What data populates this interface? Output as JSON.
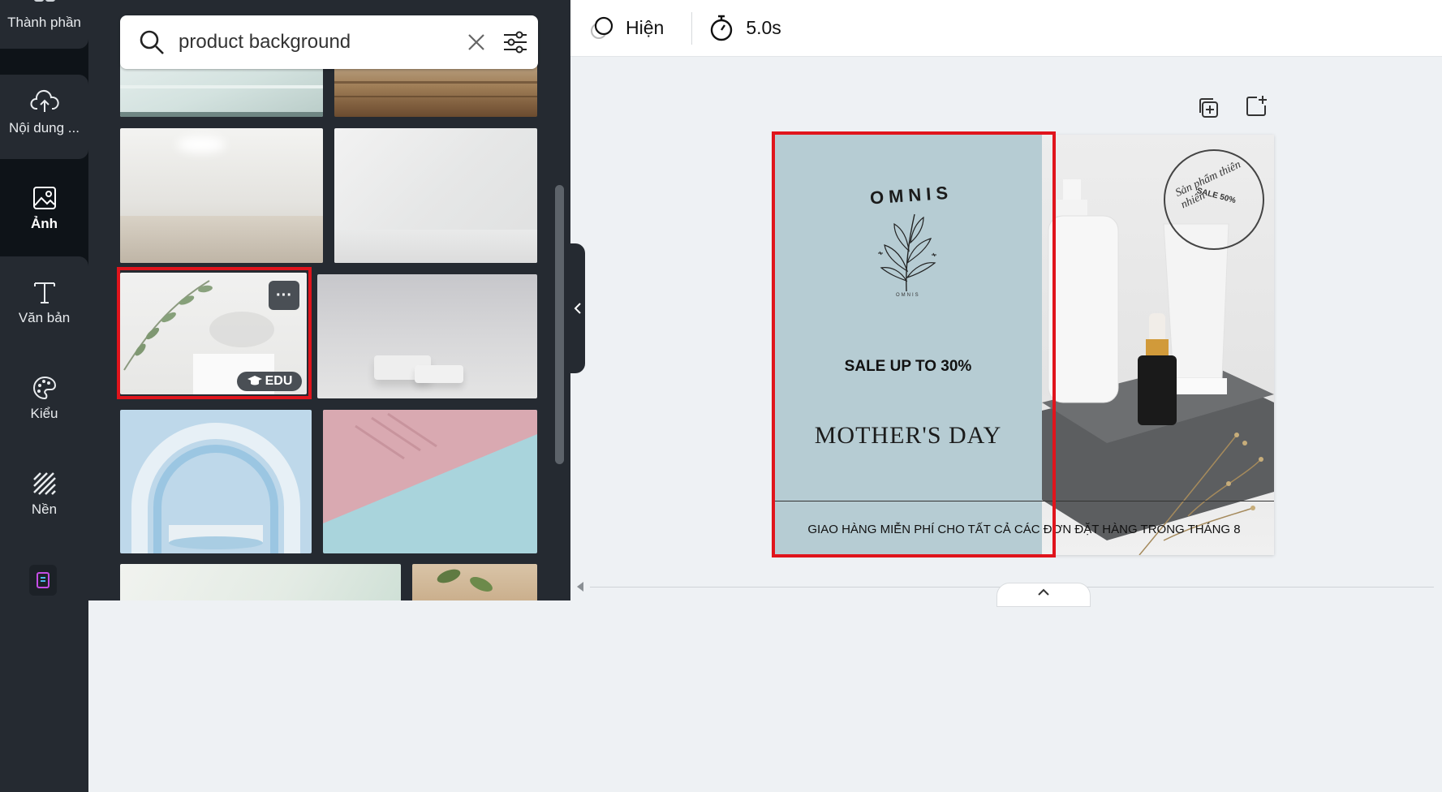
{
  "rail": {
    "items": [
      {
        "label": "Thành phần",
        "icon": "elements-icon"
      },
      {
        "label": "Nội dung ...",
        "icon": "upload-cloud-icon"
      },
      {
        "label": "Ảnh",
        "icon": "image-icon"
      },
      {
        "label": "Văn bản",
        "icon": "text-icon"
      },
      {
        "label": "Kiểu",
        "icon": "palette-icon"
      },
      {
        "label": "Nền",
        "icon": "background-icon"
      }
    ]
  },
  "search": {
    "query": "product background"
  },
  "results": {
    "more_label": "···",
    "edu_badge": "EDU"
  },
  "topbar": {
    "animate_label": "Hiện",
    "duration_label": "5.0s"
  },
  "design": {
    "brand": "OMNIS",
    "brand_small": "OMNIS",
    "sale": "SALE UP TO 30%",
    "headline": "MOTHER'S DAY",
    "shipping": "GIAO HÀNG MIỄN PHÍ CHO TẤT CẢ CÁC ĐƠN ĐẶT HÀNG TRONG THÁNG 8",
    "stamp_line1": "Sản phẩm thiên nhiên",
    "stamp_line2": "SALE 50%"
  },
  "colors": {
    "highlight": "#e0141c",
    "design_left_bg": "#b6ccd3",
    "rail_bg": "#0e1318",
    "panel_bg": "#252a31"
  }
}
